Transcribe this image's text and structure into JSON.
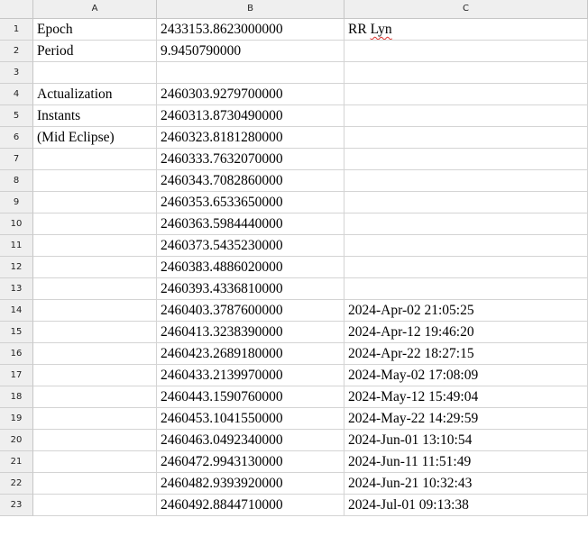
{
  "columns": [
    "A",
    "B",
    "C"
  ],
  "rows": [
    {
      "num": "1",
      "A": "Epoch",
      "B": "2433153.8623000000",
      "C_pre": "RR ",
      "C_mark": "Lyn",
      "C": ""
    },
    {
      "num": "2",
      "A": "Period",
      "B": "9.9450790000",
      "C": ""
    },
    {
      "num": "3",
      "A": "",
      "B": "",
      "C": ""
    },
    {
      "num": "4",
      "A": "Actualization",
      "B": "2460303.9279700000",
      "C": ""
    },
    {
      "num": "5",
      "A": "Instants",
      "B": "2460313.8730490000",
      "C": ""
    },
    {
      "num": "6",
      "A": "(Mid Eclipse)",
      "B": "2460323.8181280000",
      "C": ""
    },
    {
      "num": "7",
      "A": "",
      "B": "2460333.7632070000",
      "C": ""
    },
    {
      "num": "8",
      "A": "",
      "B": "2460343.7082860000",
      "C": ""
    },
    {
      "num": "9",
      "A": "",
      "B": "2460353.6533650000",
      "C": ""
    },
    {
      "num": "10",
      "A": "",
      "B": "2460363.5984440000",
      "C": ""
    },
    {
      "num": "11",
      "A": "",
      "B": "2460373.5435230000",
      "C": ""
    },
    {
      "num": "12",
      "A": "",
      "B": "2460383.4886020000",
      "C": ""
    },
    {
      "num": "13",
      "A": "",
      "B": "2460393.4336810000",
      "C": ""
    },
    {
      "num": "14",
      "A": "",
      "B": "2460403.3787600000",
      "C": "2024-Apr-02 21:05:25"
    },
    {
      "num": "15",
      "A": "",
      "B": "2460413.3238390000",
      "C": "2024-Apr-12 19:46:20"
    },
    {
      "num": "16",
      "A": "",
      "B": "2460423.2689180000",
      "C": "2024-Apr-22 18:27:15"
    },
    {
      "num": "17",
      "A": "",
      "B": "2460433.2139970000",
      "C": "2024-May-02 17:08:09"
    },
    {
      "num": "18",
      "A": "",
      "B": "2460443.1590760000",
      "C": "2024-May-12 15:49:04"
    },
    {
      "num": "19",
      "A": "",
      "B": "2460453.1041550000",
      "C": "2024-May-22 14:29:59"
    },
    {
      "num": "20",
      "A": "",
      "B": "2460463.0492340000",
      "C": "2024-Jun-01 13:10:54"
    },
    {
      "num": "21",
      "A": "",
      "B": "2460472.9943130000",
      "C": "2024-Jun-11 11:51:49"
    },
    {
      "num": "22",
      "A": "",
      "B": "2460482.9393920000",
      "C": "2024-Jun-21 10:32:43"
    },
    {
      "num": "23",
      "A": "",
      "B": "2460492.8844710000",
      "C": "2024-Jul-01 09:13:38"
    }
  ]
}
